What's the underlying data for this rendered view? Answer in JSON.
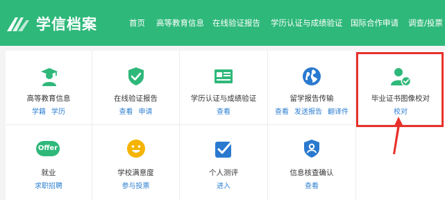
{
  "brand": {
    "name": "学信档案"
  },
  "nav": [
    {
      "label": "首页"
    },
    {
      "label": "高等教育信息"
    },
    {
      "label": "在线验证报告"
    },
    {
      "label": "学历认证与成绩验证"
    },
    {
      "label": "国际合作申请"
    },
    {
      "label": "调查/投票"
    }
  ],
  "services": [
    {
      "title": "高等教育信息",
      "icon": "graduate-user-icon",
      "links": [
        "学籍",
        "学历"
      ]
    },
    {
      "title": "在线验证报告",
      "icon": "shield-check-icon",
      "links": [
        "查看",
        "申请"
      ]
    },
    {
      "title": "学历认证与成绩验证",
      "icon": "id-card-icon",
      "links": [
        "查看"
      ]
    },
    {
      "title": "留学报告传输",
      "icon": "globe-icon",
      "links": [
        "查看",
        "发送报告",
        "翻译件"
      ]
    },
    {
      "title": "毕业证书图像校对",
      "icon": "user-check-icon",
      "links": [
        "校对"
      ]
    },
    {
      "title": "就业",
      "icon": "offer-badge-icon",
      "badge": "Offer",
      "links": [
        "求职招聘"
      ]
    },
    {
      "title": "学校满意度",
      "icon": "smiley-icon",
      "links": [
        "参与投票"
      ]
    },
    {
      "title": "个人测评",
      "icon": "checkbox-icon",
      "links": [
        "进入"
      ]
    },
    {
      "title": "信息核查确认",
      "icon": "shield-user-icon",
      "links": [
        "查看"
      ]
    }
  ],
  "colors": {
    "brand_green": "#2eb87a",
    "icon_green": "#2eb87a",
    "icon_blue": "#2a79cf",
    "icon_yellow": "#f5b400",
    "link_blue": "#2d7fd1",
    "highlight_red": "#e8302a"
  }
}
